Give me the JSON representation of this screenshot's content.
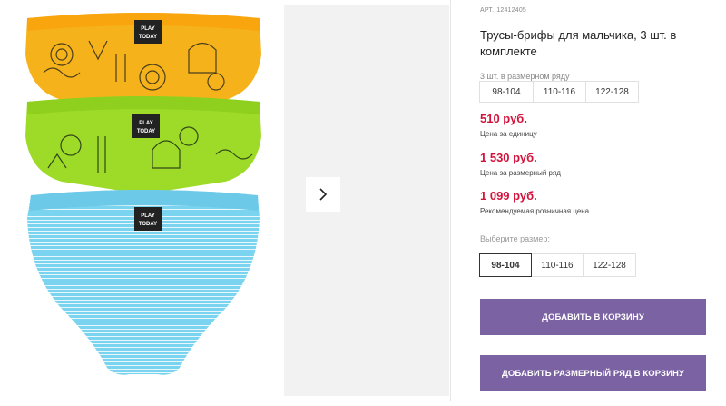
{
  "product": {
    "sku_label": "АРТ.",
    "sku": "12412405",
    "title": "Трусы-брифы для мальчика, 3 шт. в комплекте",
    "image_logo_text": "PLAY TODAY",
    "image_colors": [
      "#f6b21a",
      "#9edb29",
      "#7ad3ef"
    ]
  },
  "range_selector": {
    "label": "3 шт. в размерном ряду",
    "sizes": [
      "98-104",
      "110-116",
      "122-128"
    ]
  },
  "prices": [
    {
      "value": "510 руб.",
      "note": "Цена за единицу"
    },
    {
      "value": "1 530 руб.",
      "note": "Цена за размерный ряд"
    },
    {
      "value": "1 099 руб.",
      "note": "Рекомендуемая розничная цена"
    }
  ],
  "size_selector": {
    "label": "Выберите размер:",
    "sizes": [
      "98-104",
      "110-116",
      "122-128"
    ],
    "selected": "98-104"
  },
  "actions": {
    "add_to_cart": "ДОБАВИТЬ В КОРЗИНУ",
    "add_range_to_cart": "ДОБАВИТЬ РАЗМЕРНЫЙ РЯД В КОРЗИНУ"
  },
  "gallery": {
    "next_icon": "chevron-right-icon"
  },
  "colors": {
    "price": "#d3123b",
    "button": "#7a62a3"
  }
}
